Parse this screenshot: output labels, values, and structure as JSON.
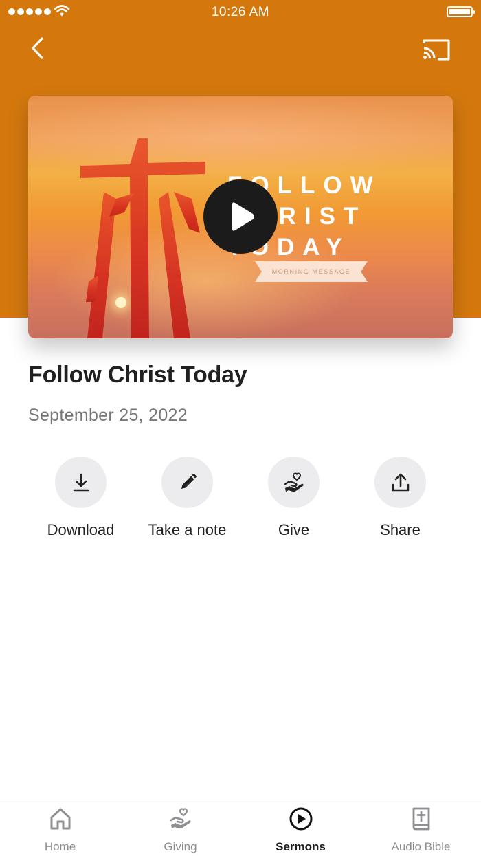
{
  "status_bar": {
    "time": "10:26 AM"
  },
  "header": {
    "background_color": "#d4780e",
    "back_icon": "chevron-left-icon",
    "cast_icon": "cast-icon"
  },
  "video": {
    "promo_line1": "FOLLOW",
    "promo_line2": "CHRIST",
    "promo_line3": "TODAY",
    "promo_tag": "MORNING MESSAGE",
    "play_icon": "play-icon"
  },
  "sermon": {
    "title": "Follow Christ Today",
    "date": "September 25, 2022"
  },
  "actions": [
    {
      "label": "Download",
      "icon": "download-icon"
    },
    {
      "label": "Take a note",
      "icon": "pencil-icon"
    },
    {
      "label": "Give",
      "icon": "heart-hand-icon"
    },
    {
      "label": "Share",
      "icon": "share-icon"
    }
  ],
  "tabs": [
    {
      "label": "Home",
      "icon": "home-icon",
      "active": false
    },
    {
      "label": "Giving",
      "icon": "heart-hand-icon",
      "active": false
    },
    {
      "label": "Sermons",
      "icon": "play-circle-icon",
      "active": true
    },
    {
      "label": "Audio Bible",
      "icon": "bible-icon",
      "active": false
    }
  ]
}
